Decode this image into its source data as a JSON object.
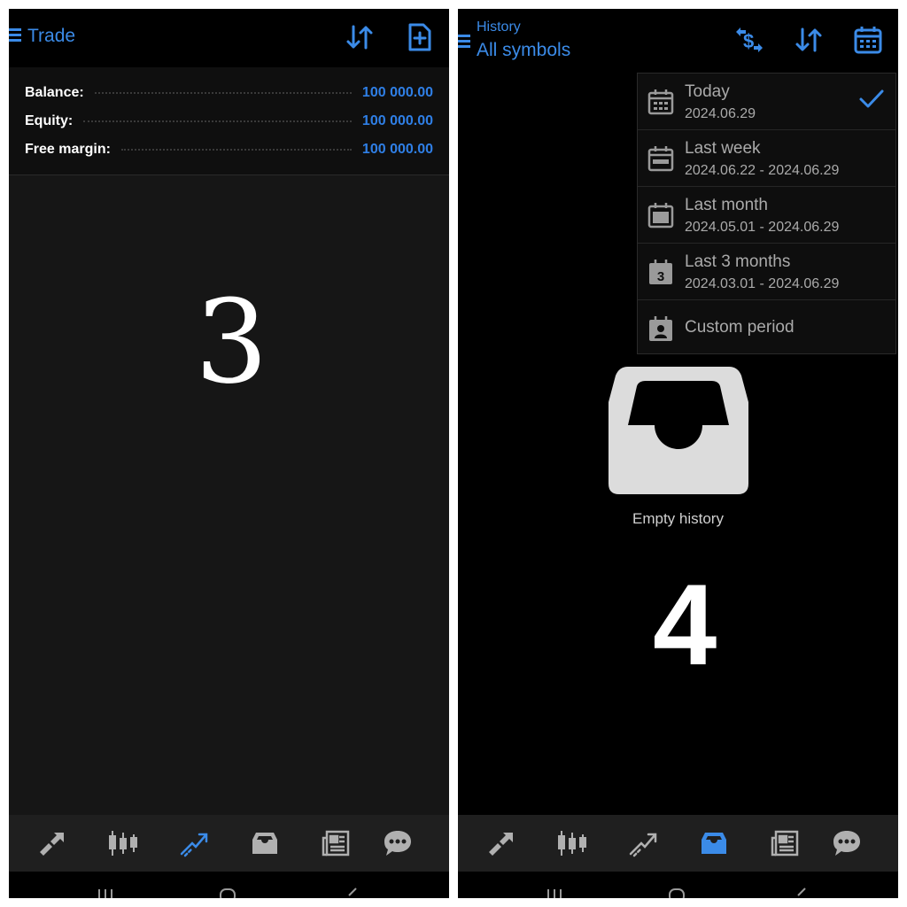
{
  "colors": {
    "accent": "#2f7fe6",
    "icon_gray": "#b0b0b0",
    "background_dark": "#161616",
    "background_black": "#000000"
  },
  "left_screen": {
    "title": "Trade",
    "step_number": "3",
    "account": [
      {
        "label": "Balance:",
        "value": "100 000.00"
      },
      {
        "label": "Equity:",
        "value": "100 000.00"
      },
      {
        "label": "Free margin:",
        "value": "100 000.00"
      }
    ],
    "toolbar_icons": [
      "sort-icon",
      "new-order-icon"
    ],
    "active_tab": "trade"
  },
  "right_screen": {
    "subtitle": "History",
    "title": "All symbols",
    "step_number": "4",
    "toolbar_icons": [
      "currency-exchange-icon",
      "sort-icon",
      "calendar-icon"
    ],
    "period_menu": [
      {
        "label": "Today",
        "range": "2024.06.29",
        "icon": "calendar-today-icon",
        "selected": true
      },
      {
        "label": "Last week",
        "range": "2024.06.22 - 2024.06.29",
        "icon": "calendar-week-icon",
        "selected": false
      },
      {
        "label": "Last month",
        "range": "2024.05.01 - 2024.06.29",
        "icon": "calendar-month-icon",
        "selected": false
      },
      {
        "label": "Last 3 months",
        "range": "2024.03.01 - 2024.06.29",
        "icon": "calendar-3-months-icon",
        "icon_text": "3",
        "selected": false
      },
      {
        "label": "Custom period",
        "icon": "calendar-custom-icon",
        "selected": false
      }
    ],
    "empty_state": "Empty history",
    "active_tab": "history"
  },
  "tabs": [
    "quotes-icon",
    "chart-icon",
    "trade-icon",
    "history-icon",
    "news-icon",
    "messages-icon"
  ]
}
